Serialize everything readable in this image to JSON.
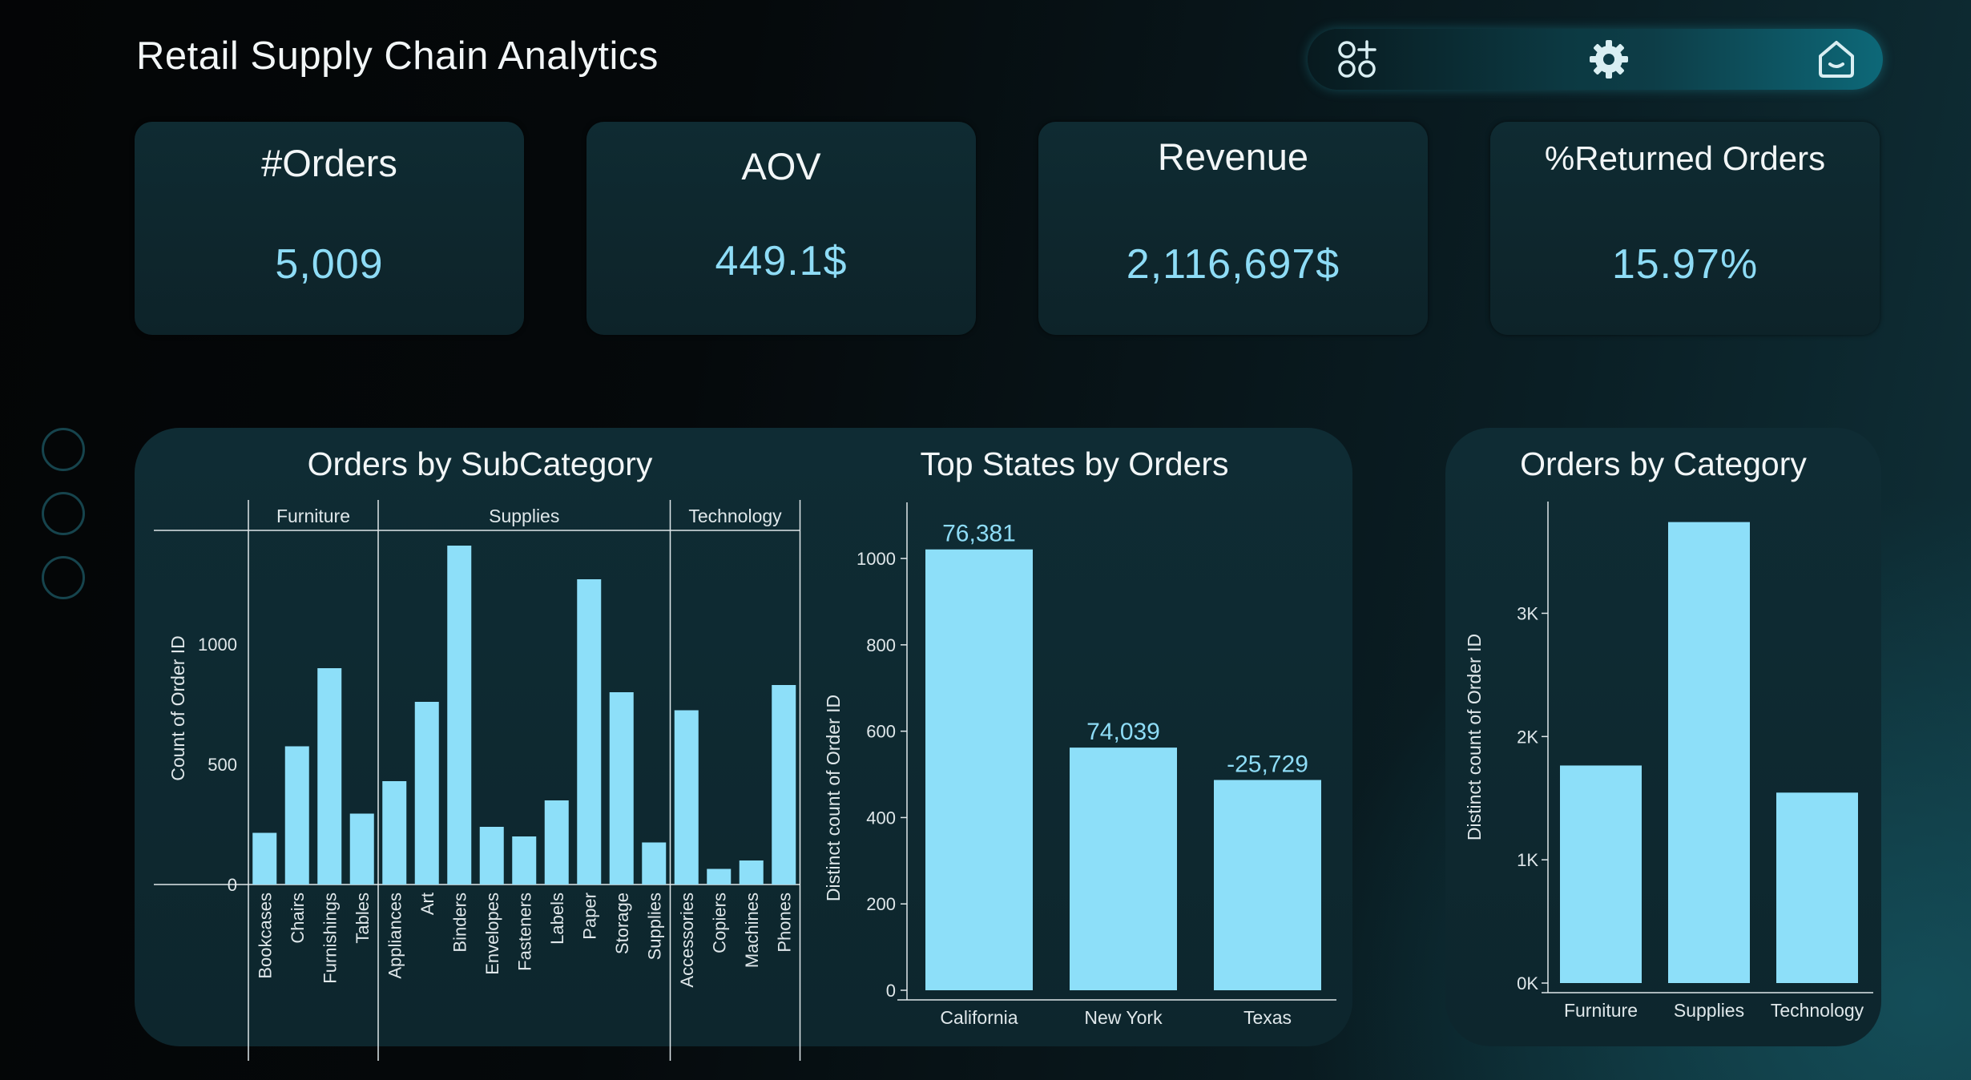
{
  "header": {
    "title": "Retail Supply Chain Analytics"
  },
  "toolbar": {
    "icons": [
      "apps-add-icon",
      "gear-icon",
      "home-icon"
    ]
  },
  "kpis": [
    {
      "label": "#Orders",
      "value": "5,009"
    },
    {
      "label": "AOV",
      "value": "449.1$"
    },
    {
      "label": "Revenue",
      "value": "2,116,697$"
    },
    {
      "label": "%Returned Orders",
      "value": "15.97%"
    }
  ],
  "colors": {
    "bar": "#8ddff9",
    "axis": "#dfe7ea",
    "text": "#f2f6f7",
    "value": "#8edcf6",
    "panel": "#0f2b32"
  },
  "chart_data": [
    {
      "type": "bar",
      "title": "Orders by SubCategory",
      "ylabel": "Count of Order ID",
      "xlabel": "",
      "ylim": [
        0,
        1400
      ],
      "yticks": [
        0,
        500,
        1000
      ],
      "grid": false,
      "groups": [
        {
          "name": "Furniture",
          "categories": [
            "Bookcases",
            "Chairs",
            "Furnishings",
            "Tables"
          ],
          "values": [
            215,
            575,
            900,
            295
          ]
        },
        {
          "name": "Supplies",
          "categories": [
            "Appliances",
            "Art",
            "Binders",
            "Envelopes",
            "Fasteners",
            "Labels",
            "Paper",
            "Storage",
            "Supplies"
          ],
          "values": [
            430,
            760,
            1410,
            240,
            200,
            350,
            1270,
            800,
            175
          ]
        },
        {
          "name": "Technology",
          "categories": [
            "Accessories",
            "Copiers",
            "Machines",
            "Phones"
          ],
          "values": [
            725,
            65,
            100,
            830
          ]
        }
      ]
    },
    {
      "type": "bar",
      "title": "Top States by Orders",
      "ylabel": "Distinct count of Order ID",
      "xlabel": "",
      "ylim": [
        0,
        1130
      ],
      "yticks": [
        0,
        200,
        400,
        600,
        800,
        1000
      ],
      "grid": false,
      "categories": [
        "California",
        "New York",
        "Texas"
      ],
      "values": [
        1021,
        562,
        487
      ],
      "data_labels": [
        "76,381",
        "74,039",
        "-25,729"
      ]
    },
    {
      "type": "bar",
      "title": "Orders by Category",
      "ylabel": "Distinct count of Order ID",
      "xlabel": "",
      "ylim": [
        0,
        3900
      ],
      "yticks": [
        0,
        1000,
        2000,
        3000
      ],
      "ytick_labels": [
        "0K",
        "1K",
        "2K",
        "3K"
      ],
      "grid": false,
      "categories": [
        "Furniture",
        "Supplies",
        "Technology"
      ],
      "values": [
        1765,
        3740,
        1545
      ]
    }
  ]
}
